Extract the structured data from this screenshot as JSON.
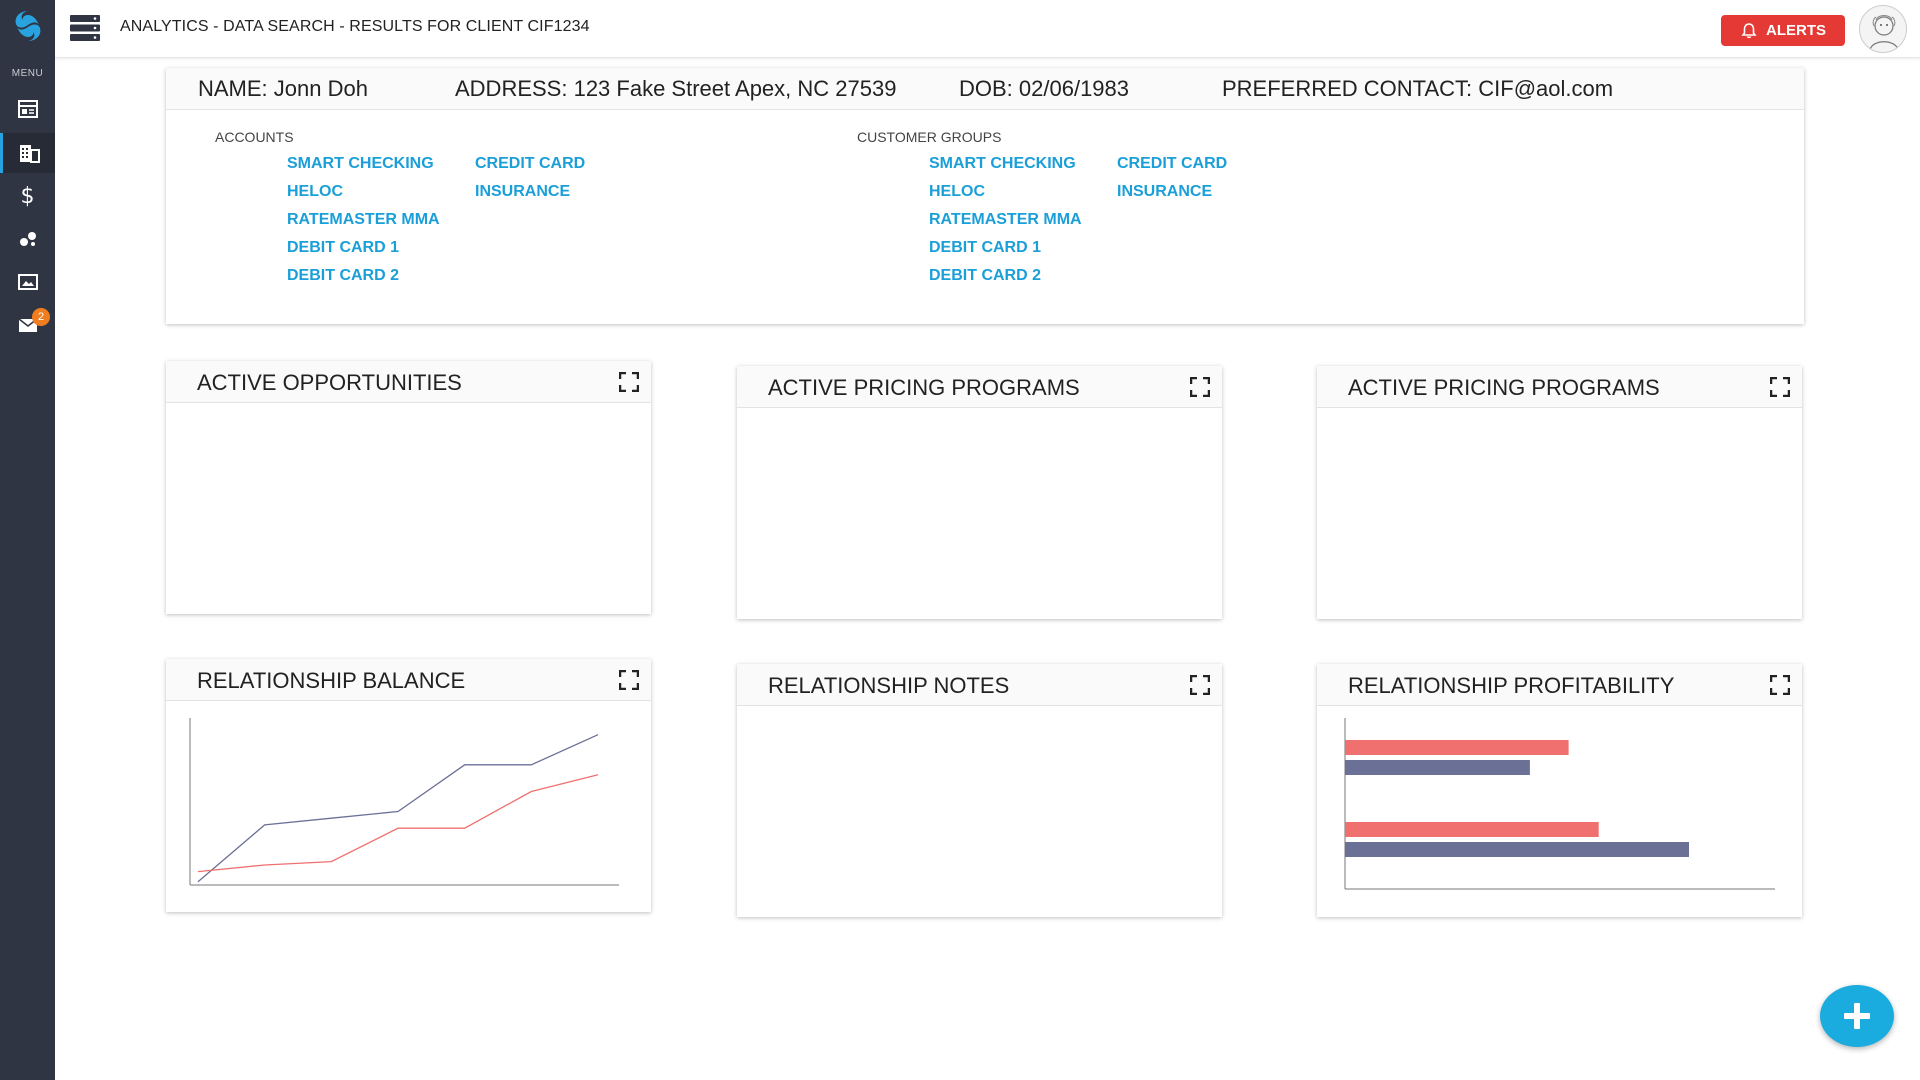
{
  "app": {
    "title": "ANALYTICS - DATA SEARCH - RESULTS FOR CLIENT CIF1234",
    "menu_label": "MENU",
    "alerts_label": "ALERTS",
    "mail_badge_count": "2",
    "accent_color": "#1a9fd8",
    "alert_color": "#e53935",
    "sidebar_color": "#2f3542"
  },
  "sidebar": {
    "items": [
      {
        "icon": "dashboard-icon"
      },
      {
        "icon": "building-icon",
        "active": true
      },
      {
        "icon": "dollar-icon",
        "glyph": "$"
      },
      {
        "icon": "bubbles-icon"
      },
      {
        "icon": "image-icon"
      },
      {
        "icon": "mail-icon"
      }
    ]
  },
  "client": {
    "name": "NAME: Jonn Doh",
    "address": "ADDRESS: 123 Fake Street Apex, NC 27539",
    "dob": "DOB: 02/06/1983",
    "contact": "PREFERRED CONTACT: CIF@aol.com",
    "accounts_label": "ACCOUNTS",
    "groups_label": "CUSTOMER GROUPS",
    "accounts_col1": [
      "SMART CHECKING",
      "HELOC",
      "RATEMASTER MMA",
      "DEBIT CARD 1",
      "DEBIT CARD 2"
    ],
    "accounts_col2": [
      "CREDIT CARD",
      "INSURANCE"
    ],
    "groups_col1": [
      "SMART CHECKING",
      "HELOC",
      "RATEMASTER MMA",
      "DEBIT CARD 1",
      "DEBIT CARD 2"
    ],
    "groups_col2": [
      "CREDIT CARD",
      "INSURANCE"
    ]
  },
  "widgets": {
    "opportunities": "ACTIVE OPPORTUNITIES",
    "pricing1": "ACTIVE PRICING PROGRAMS",
    "pricing2": "ACTIVE PRICING PROGRAMS",
    "balance": "RELATIONSHIP BALANCE",
    "notes": "RELATIONSHIP NOTES",
    "profitability": "RELATIONSHIP PROFITABILITY"
  },
  "chart_data": [
    {
      "chart": "relationship-balance",
      "type": "line",
      "x": [
        0,
        1,
        2,
        3,
        4,
        5,
        6
      ],
      "series": [
        {
          "values": [
            1,
            18,
            20,
            22,
            36,
            36,
            45
          ],
          "color": "#6b7096"
        },
        {
          "values": [
            4,
            6,
            7,
            17,
            17,
            28,
            33
          ],
          "color": "#f07070"
        }
      ],
      "ylim": [
        0,
        50
      ],
      "grid": false
    },
    {
      "chart": "relationship-profitability",
      "type": "bar",
      "orientation": "horizontal",
      "categories": [
        "",
        ""
      ],
      "series": [
        {
          "values": [
            52,
            59
          ],
          "color": "#f07070"
        },
        {
          "values": [
            43,
            80
          ],
          "color": "#6b7096"
        }
      ],
      "xlim": [
        0,
        100
      ],
      "grid": false
    }
  ]
}
